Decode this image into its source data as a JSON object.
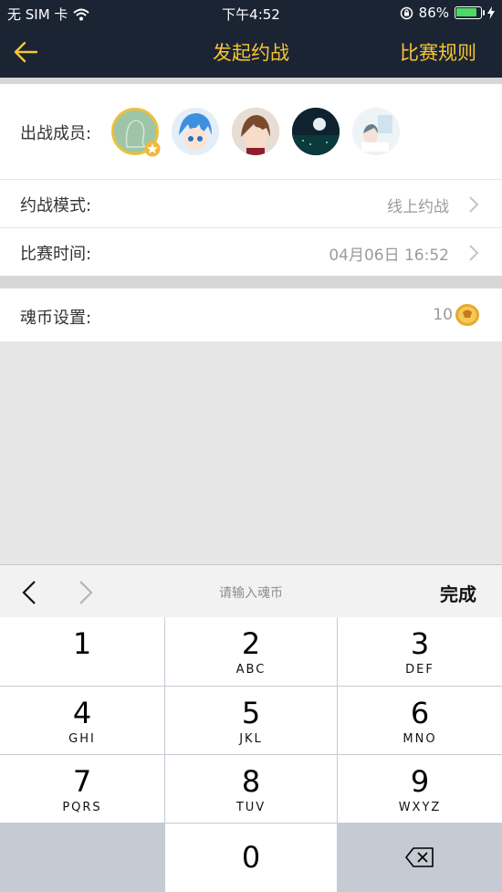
{
  "status": {
    "carrier": "无 SIM 卡",
    "time": "下午4:52",
    "battery_percent": "86%",
    "battery_level": 0.86
  },
  "nav": {
    "back_icon": "arrow-left-icon",
    "title": "发起约战",
    "rules_label": "比赛规则",
    "accent_color": "#f7c531"
  },
  "members": {
    "label": "出战成员:",
    "avatars": [
      "avatar-self",
      "avatar-blue-hair",
      "avatar-brown-hair",
      "avatar-night-moon",
      "avatar-white-room"
    ]
  },
  "mode": {
    "label": "约战模式:",
    "value": "线上约战"
  },
  "match_time": {
    "label": "比赛时间:",
    "value": "04月06日 16:52"
  },
  "coins": {
    "label": "魂币设置:",
    "value": "10",
    "icon": "coin-icon"
  },
  "keyboard_bar": {
    "prev_icon": "chevron-left-icon",
    "next_icon": "chevron-right-icon",
    "placeholder": "请输入魂币",
    "done_label": "完成"
  },
  "keypad": {
    "keys": [
      {
        "num": "1",
        "letters": ""
      },
      {
        "num": "2",
        "letters": "ABC"
      },
      {
        "num": "3",
        "letters": "DEF"
      },
      {
        "num": "4",
        "letters": "GHI"
      },
      {
        "num": "5",
        "letters": "JKL"
      },
      {
        "num": "6",
        "letters": "MNO"
      },
      {
        "num": "7",
        "letters": "PQRS"
      },
      {
        "num": "8",
        "letters": "TUV"
      },
      {
        "num": "9",
        "letters": "WXYZ"
      },
      {
        "num": "0",
        "letters": ""
      }
    ],
    "delete_icon": "backspace-icon"
  }
}
